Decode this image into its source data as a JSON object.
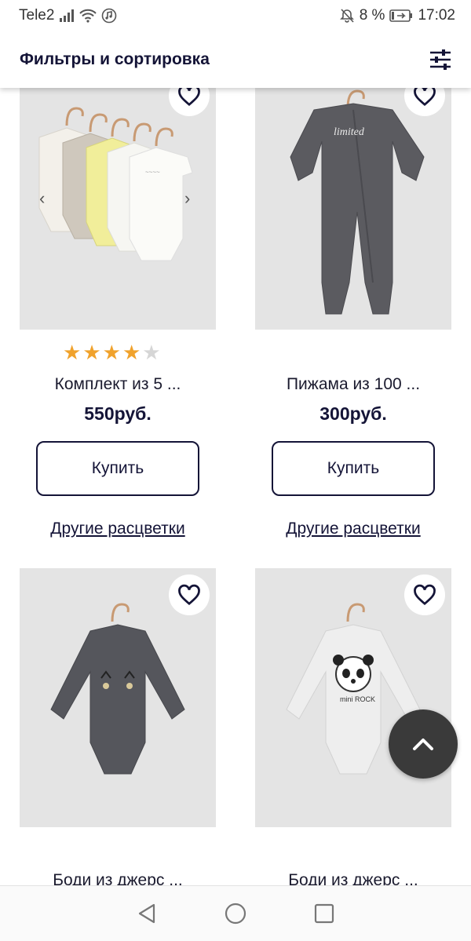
{
  "status_bar": {
    "carrier": "Tele2",
    "battery": "8 %",
    "time": "17:02",
    "icons": [
      "signal-icon",
      "wifi-icon",
      "music-icon",
      "mute-icon",
      "battery-charging-icon"
    ]
  },
  "header": {
    "title": "Фильтры и сортировка",
    "filter_icon": "filter-sliders-icon"
  },
  "products": [
    {
      "name": "Комплект из 5 ...",
      "price": "550руб.",
      "rating": 4,
      "rating_max": 5,
      "buy_label": "Купить",
      "colors_label": "Другие расцветки",
      "image_icon": "bodysuit-set-image"
    },
    {
      "name": "Пижама из 100 ...",
      "price": "300руб.",
      "buy_label": "Купить",
      "colors_label": "Другие расцветки",
      "image_icon": "pajama-image",
      "print_text": "limited"
    },
    {
      "name": "Боди из джерс ...",
      "image_icon": "dark-bodysuit-image"
    },
    {
      "name": "Боди из джерс ...",
      "image_icon": "panda-bodysuit-image",
      "print_text": "mini ROCK"
    }
  ],
  "scroll_top": {
    "icon": "chevron-up-icon"
  },
  "nav_bar": {
    "icons": [
      "back-icon",
      "home-icon",
      "recents-icon"
    ]
  },
  "colors": {
    "brand_navy": "#141437",
    "star": "#f0a22c",
    "image_bg": "#e4e4e4",
    "scroll_btn": "#3a3a3a"
  }
}
